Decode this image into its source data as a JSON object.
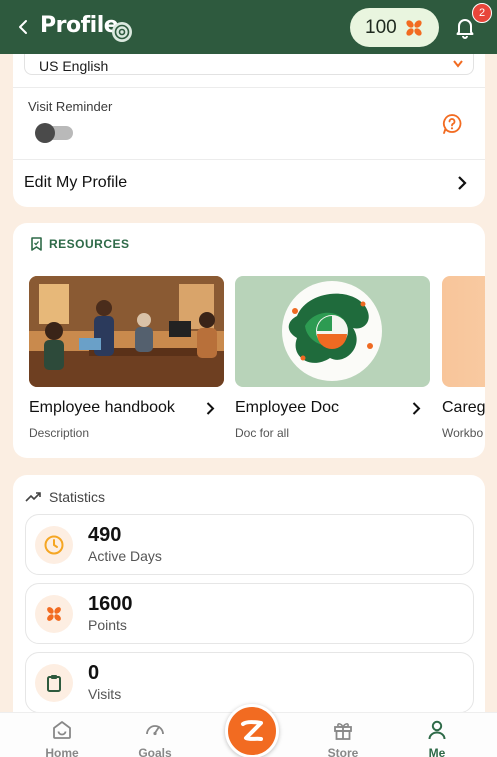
{
  "header": {
    "title": "Profile",
    "points": "100",
    "notification_count": "2"
  },
  "settings": {
    "language_value": "US English",
    "visit_reminder_label": "Visit Reminder",
    "visit_reminder_on": false,
    "edit_profile_label": "Edit My Profile"
  },
  "resources": {
    "heading": "RESOURCES",
    "items": [
      {
        "title": "Employee handbook",
        "description": "Description"
      },
      {
        "title": "Employee Doc",
        "description": "Doc for all"
      },
      {
        "title": "Careg",
        "description": "Workbo"
      }
    ]
  },
  "statistics": {
    "heading": "Statistics",
    "items": [
      {
        "value": "490",
        "label": "Active Days",
        "icon": "clock-icon"
      },
      {
        "value": "1600",
        "label": "Points",
        "icon": "points-icon"
      },
      {
        "value": "0",
        "label": "Visits",
        "icon": "clipboard-icon"
      }
    ]
  },
  "nav": {
    "items": [
      {
        "label": "Home",
        "icon": "home-icon"
      },
      {
        "label": "Goals",
        "icon": "gauge-icon"
      },
      {
        "label": "Store",
        "icon": "gift-icon"
      },
      {
        "label": "Me",
        "icon": "person-icon"
      }
    ],
    "active": "Me"
  },
  "colors": {
    "brand_green": "#2e5a3e",
    "accent_orange": "#f26b21",
    "background": "#fbeee2"
  }
}
